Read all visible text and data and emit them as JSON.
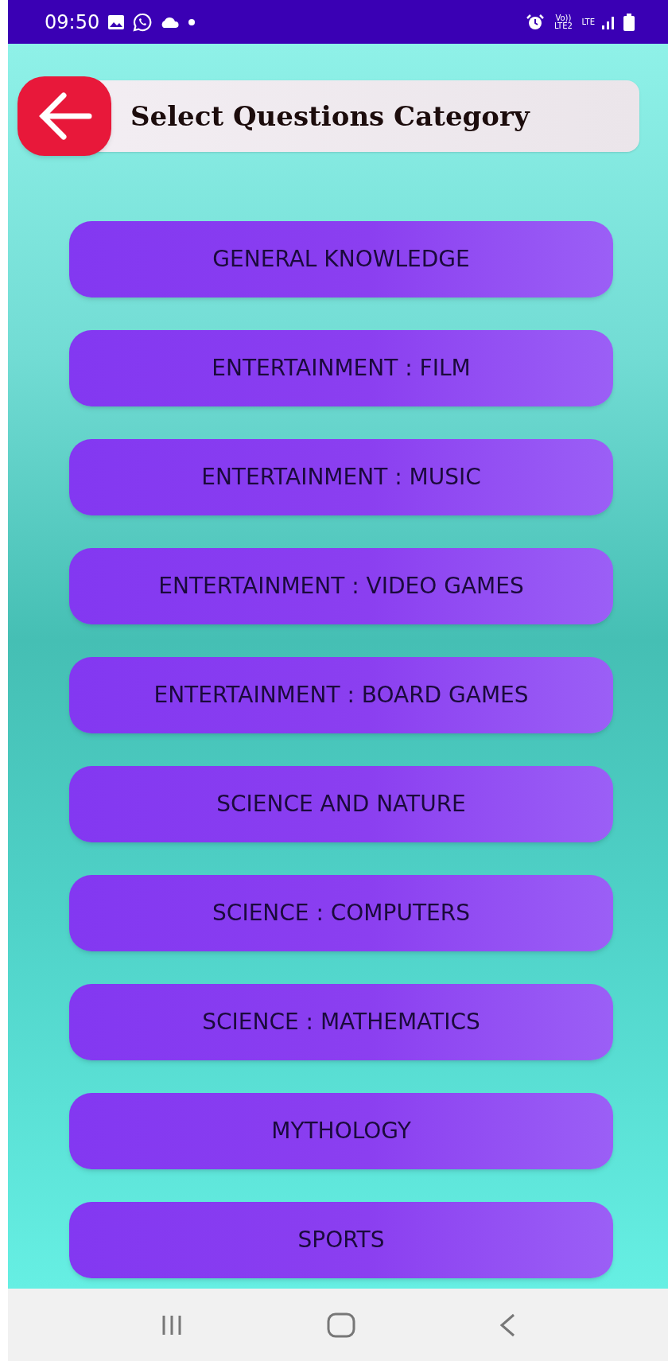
{
  "status_bar": {
    "time": "09:50",
    "network": "Vo)) LTE2",
    "data": "LTE"
  },
  "header": {
    "title": "Select Questions Category"
  },
  "categories": [
    {
      "label": "GENERAL KNOWLEDGE"
    },
    {
      "label": "ENTERTAINMENT : FILM"
    },
    {
      "label": "ENTERTAINMENT : MUSIC"
    },
    {
      "label": "ENTERTAINMENT : VIDEO GAMES"
    },
    {
      "label": "ENTERTAINMENT : BOARD GAMES"
    },
    {
      "label": "SCIENCE AND NATURE"
    },
    {
      "label": "SCIENCE : COMPUTERS"
    },
    {
      "label": "SCIENCE : MATHEMATICS"
    },
    {
      "label": "MYTHOLOGY"
    },
    {
      "label": "SPORTS"
    }
  ]
}
